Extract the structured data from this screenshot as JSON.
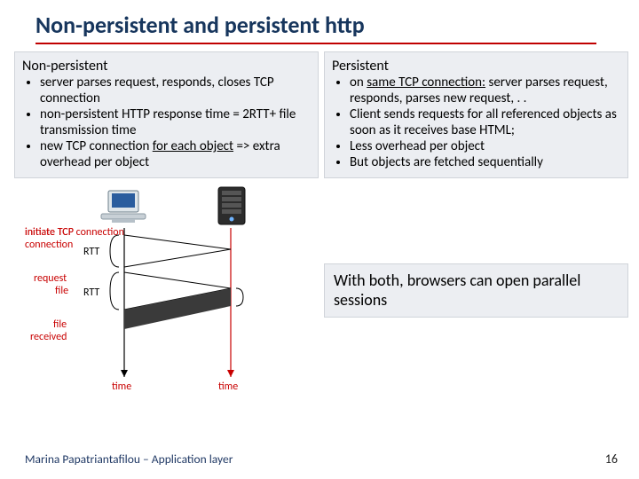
{
  "title": "Non-persistent and persistent http",
  "left": {
    "heading": "Non-persistent",
    "items": [
      "server parses request, responds, closes TCP connection",
      "non-persistent HTTP response time = 2RTT+ file transmission time",
      "new TCP connection for each object => extra overhead per object"
    ],
    "item2_pre": "new TCP connection ",
    "item2_u": "for each object",
    "item2_post": " => extra overhead per object"
  },
  "right": {
    "heading": "Persistent",
    "item0_pre": "on ",
    "item0_u": "same TCP connection:",
    "item0_post": " server parses request, responds, parses new request, . .",
    "item1": "Client sends requests for all referenced objects as soon as it receives base HTML;",
    "item2": "Less overhead per object",
    "item3": "But objects are fetched sequentially"
  },
  "callout": "With both, browsers can open parallel sessions",
  "diagram": {
    "initiate": "initiate TCP connection",
    "rtt1": "RTT",
    "request": "request file",
    "rtt2": "RTT",
    "file_recv": "file received",
    "time_l": "time",
    "time_r": "time"
  },
  "footer": {
    "author": "Marina Papatriantafilou – Application layer",
    "page": "16"
  }
}
